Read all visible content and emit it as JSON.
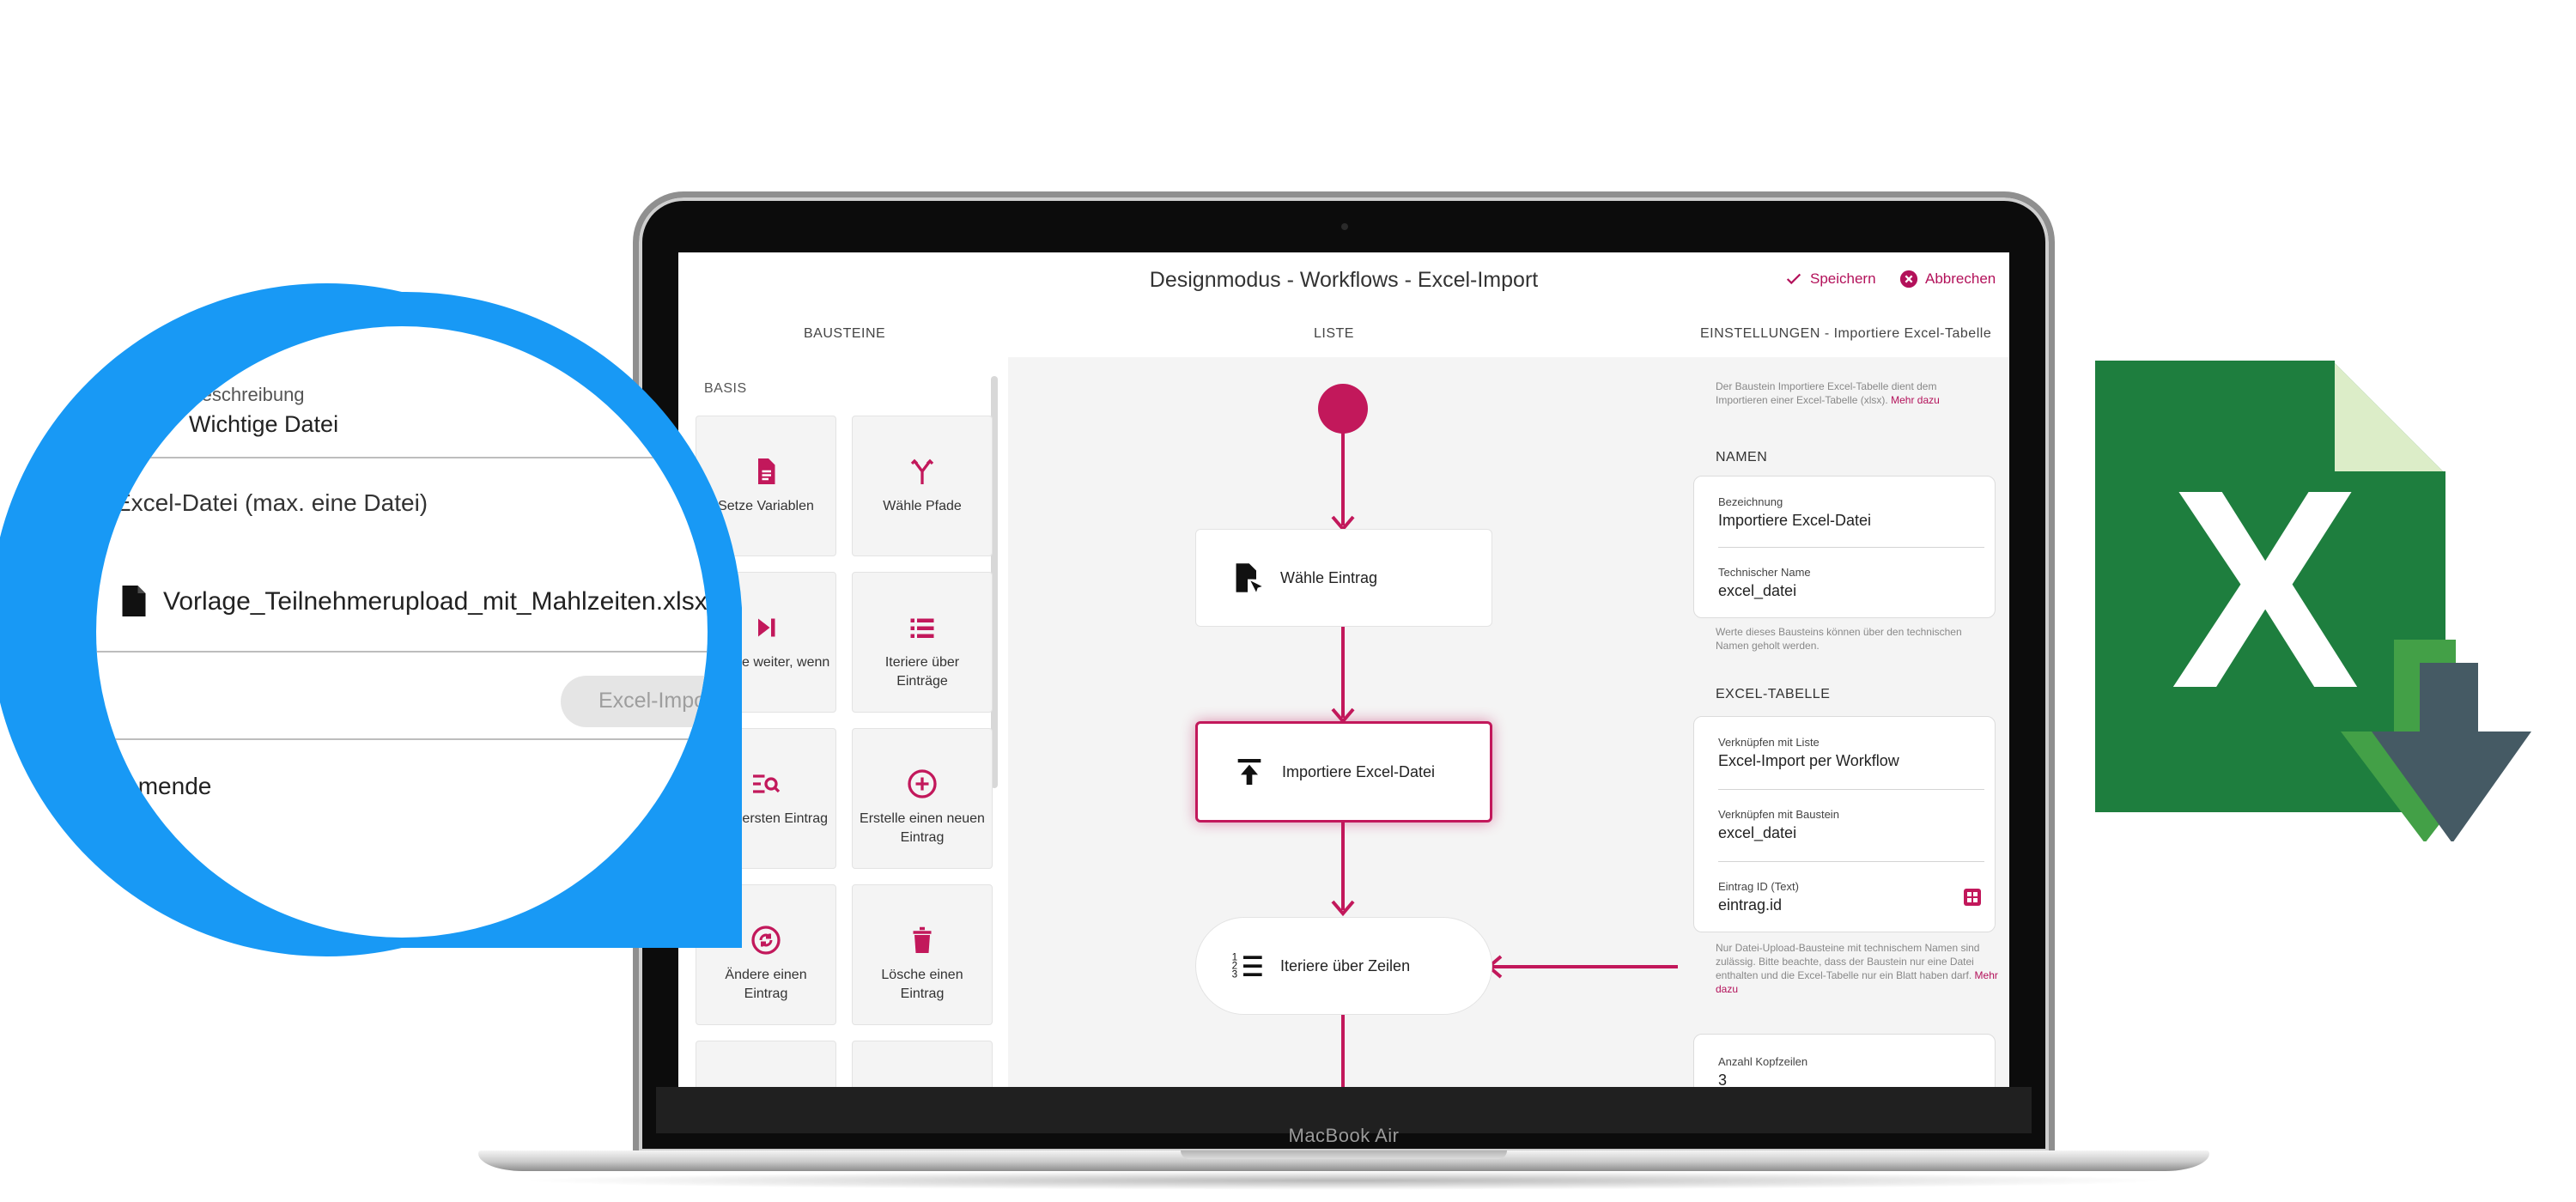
{
  "app": {
    "title": "Designmodus - Workflows - Excel-Import",
    "save_label": "Speichern",
    "cancel_label": "Abbrechen"
  },
  "columns": {
    "left": "BAUSTEINE",
    "middle": "LISTE",
    "right": "EINSTELLUNGEN - Importiere Excel-Tabelle"
  },
  "palette": {
    "section": "BASIS",
    "tiles": [
      {
        "label": "Setze Variablen",
        "icon": "file-text-icon"
      },
      {
        "label": "Wähle Pfade",
        "icon": "fork-paths-icon"
      },
      {
        "label": "Springe weiter, wenn",
        "icon": "skip-next-icon"
      },
      {
        "label": "Iteriere über Einträge",
        "icon": "list-icon"
      },
      {
        "label": "Finde ersten Eintrag",
        "icon": "find-list-icon"
      },
      {
        "label": "Erstelle einen neuen Eintrag",
        "icon": "plus-circle-icon"
      },
      {
        "label": "Ändere einen Eintrag",
        "icon": "sync-circle-icon"
      },
      {
        "label": "Lösche einen Eintrag",
        "icon": "trash-icon"
      }
    ]
  },
  "flow": {
    "nodes": [
      {
        "label": "Wähle Eintrag",
        "icon": "file-select-icon"
      },
      {
        "label": "Importiere Excel-Datei",
        "icon": "upload-icon"
      },
      {
        "label": "Iteriere über Zeilen",
        "icon": "numbered-list-icon"
      }
    ]
  },
  "settings": {
    "intro": "Der Baustein Importiere Excel-Tabelle dient dem Importieren einer Excel-Tabelle (xlsx).",
    "intro_link": "Mehr dazu",
    "names_heading": "NAMEN",
    "name_label": "Bezeichnung",
    "name_value": "Importiere Excel-Datei",
    "tech_label": "Technischer Name",
    "tech_value": "excel_datei",
    "names_hint": "Werte dieses Bausteins können über den technischen Namen geholt werden.",
    "table_heading": "EXCEL-TABELLE",
    "link_list_label": "Verknüpfen mit Liste",
    "link_list_value": "Excel-Import per Workflow",
    "link_block_label": "Verknüpfen mit Baustein",
    "link_block_value": "excel_datei",
    "entry_label": "Eintrag ID (Text)",
    "entry_value": "eintrag.id",
    "table_hint": "Nur Datei-Upload-Bausteine mit technischem Namen sind zulässig. Bitte beachte, dass der Baustein nur eine Datei enthalten und die Excel-Tabelle nur ein Blatt haben darf.",
    "table_hint_link": "Mehr dazu",
    "header_rows_label": "Anzahl Kopfzeilen",
    "header_rows_value": "3"
  },
  "magnifier": {
    "desc_label": "Beschreibung",
    "desc_value": "Wichtige Datei",
    "upload_label": "Excel-Datei (max. eine Datei)",
    "file_name": "Vorlage_Teilnehmerupload_mit_Mahlzeiten.xlsx",
    "import_button": "Excel-Import",
    "participants_label": "Teilnehmende"
  },
  "device_label": "MacBook Air",
  "colors": {
    "accent": "#c2185b",
    "magnifier_ring": "#1899f5",
    "excel_green": "#1e7e3e",
    "download_arrow": "#455a64"
  }
}
